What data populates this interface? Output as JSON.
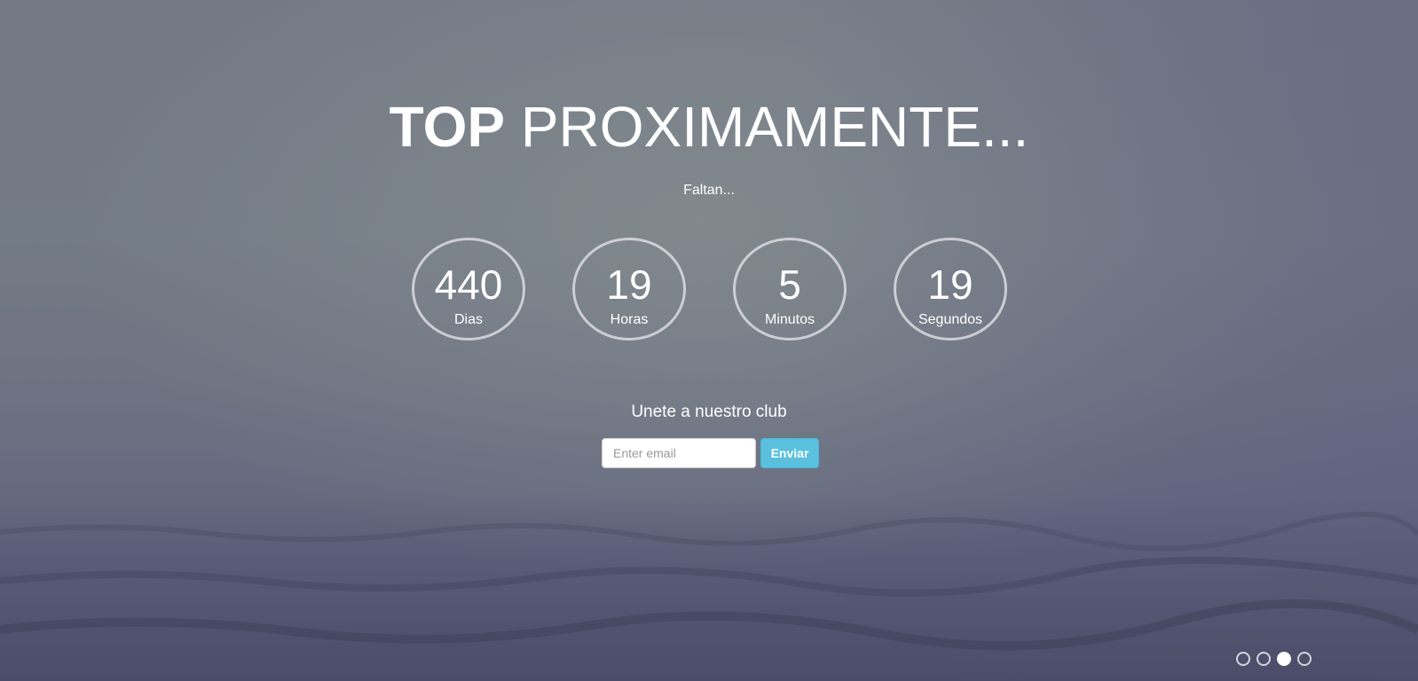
{
  "title": {
    "bold": "TOP",
    "light": "PROXIMAMENTE..."
  },
  "subtitle": "Faltan...",
  "countdown": [
    {
      "value": "440",
      "label": "Dias"
    },
    {
      "value": "19",
      "label": "Horas"
    },
    {
      "value": "5",
      "label": "Minutos"
    },
    {
      "value": "19",
      "label": "Segundos"
    }
  ],
  "signup": {
    "title": "Unete a nuestro club",
    "email_placeholder": "Enter email",
    "email_value": "",
    "button_label": "Enviar"
  },
  "slider": {
    "count": 4,
    "active_index": 2
  },
  "colors": {
    "button": "#5bc0de",
    "text": "#ffffff"
  }
}
